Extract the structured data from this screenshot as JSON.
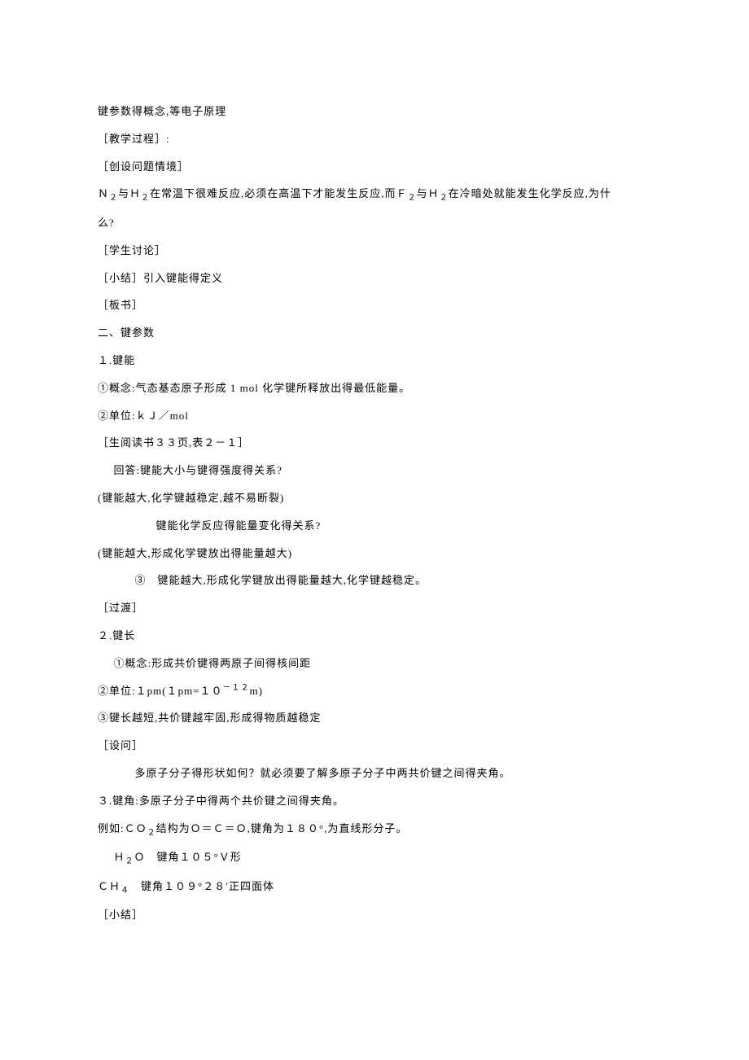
{
  "lines": {
    "l0": "键参数得概念,等电子原理",
    "l1": "［教学过程］:",
    "l2": "［创设问题情境］",
    "l3a": "Ｎ",
    "l3b": "与Ｈ",
    "l3c": "在常温下很难反应,必须在高温下才能发生反应,而Ｆ",
    "l3d": "与Ｈ",
    "l3e": "在冷暗处就能发生化学反应,为什",
    "l4": "么?",
    "l5": "［学生讨论］",
    "l6": "［小结］引入键能得定义",
    "l7": "［板书］",
    "l8": "二、键参数",
    "l9": "１.键能",
    "l10": "①概念:气态基态原子形成 1 mol 化学键所释放出得最低能量。",
    "l11": "②单位:ｋＪ／mol",
    "l12": "［生阅读书３３页,表２－１］",
    "l13": "回答:键能大小与键得强度得关系?",
    "l14": "(键能越大,化学键越稳定,越不易断裂)",
    "l15": "键能化学反应得能量变化得关系?",
    "l16": "(键能越大,形成化学键放出得能量越大)",
    "l17": "③　键能越大,形成化学键放出得能量越大,化学键越稳定。",
    "l18": "［过渡］",
    "l19": "２.键长",
    "l20": "①概念:形成共价键得两原子间得核间距",
    "l21a": "②单位:１pm(１pm=１０",
    "l21b": "m)",
    "l22": "③键长越短,共价键越牢固,形成得物质越稳定",
    "l23": "［设问］",
    "l24": "多原子分子得形状如何？就必须要了解多原子分子中两共价键之间得夹角。",
    "l25": "３.键角:多原子分子中得两个共价键之间得夹角。",
    "l26a": "例如:ＣＯ",
    "l26b": "结构为Ｏ＝Ｃ＝Ｏ,键角为１８０°,为直线形分子。",
    "l27a": "Ｈ",
    "l27b": "Ｏ　键角１０５°Ｖ形",
    "l28a": "ＣＨ",
    "l28b": "　键角１０９°２８′正四面体",
    "l29": "［小结］",
    "sub2": "２",
    "sub4": "４",
    "supn12": "－１２"
  }
}
